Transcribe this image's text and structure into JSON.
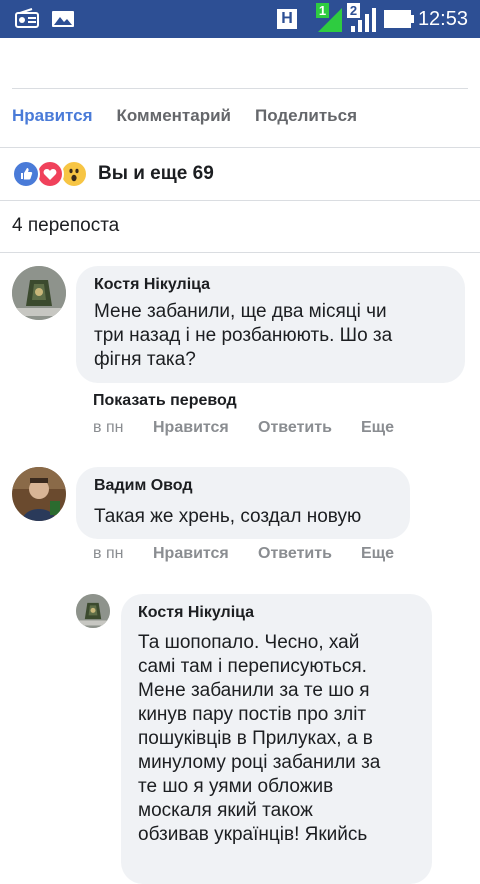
{
  "status_bar": {
    "time": "12:53",
    "network_badge": "H",
    "sim1": "1",
    "sim2": "2",
    "icons": [
      "radio-icon",
      "gallery-icon",
      "signal-icon",
      "battery-icon"
    ]
  },
  "post_actions": {
    "like": "Нравится",
    "comment": "Комментарий",
    "share": "Поделиться"
  },
  "reactions": {
    "icons": [
      "like",
      "love",
      "wow"
    ],
    "summary": "Вы и еще 69"
  },
  "shares": "4 перепоста",
  "comments": [
    {
      "author": "Костя Нікуліца",
      "lines": [
        "Мене забанили, ще два місяці чи",
        "три назад і не розбанюють. Шо за",
        "фігня така?"
      ],
      "translate": "Показать перевод",
      "time": "в пн",
      "like": "Нравится",
      "reply": "Ответить",
      "more": "Еще"
    },
    {
      "author": "Вадим Овод",
      "lines": [
        "Такая же хрень, создал новую"
      ],
      "time": "в пн",
      "like": "Нравится",
      "reply": "Ответить",
      "more": "Еще"
    },
    {
      "author": "Костя Нікуліца",
      "lines": [
        "Та шопопало. Чесно, хай",
        "самі там і переписуються.",
        "Мене забанили за те шо я",
        "кинув пару постів про зліт",
        "пошуківців в Прилуках, а в",
        "минулому році забанили за",
        "те шо я уями обложив",
        "москаля який також",
        "обзивав українців! Якийсь"
      ]
    }
  ],
  "colors": {
    "status_bar": "#2d4f94",
    "liked_blue": "#4a7bd8",
    "bubble": "#f0f2f5",
    "meta_gray": "#8a8d91"
  }
}
